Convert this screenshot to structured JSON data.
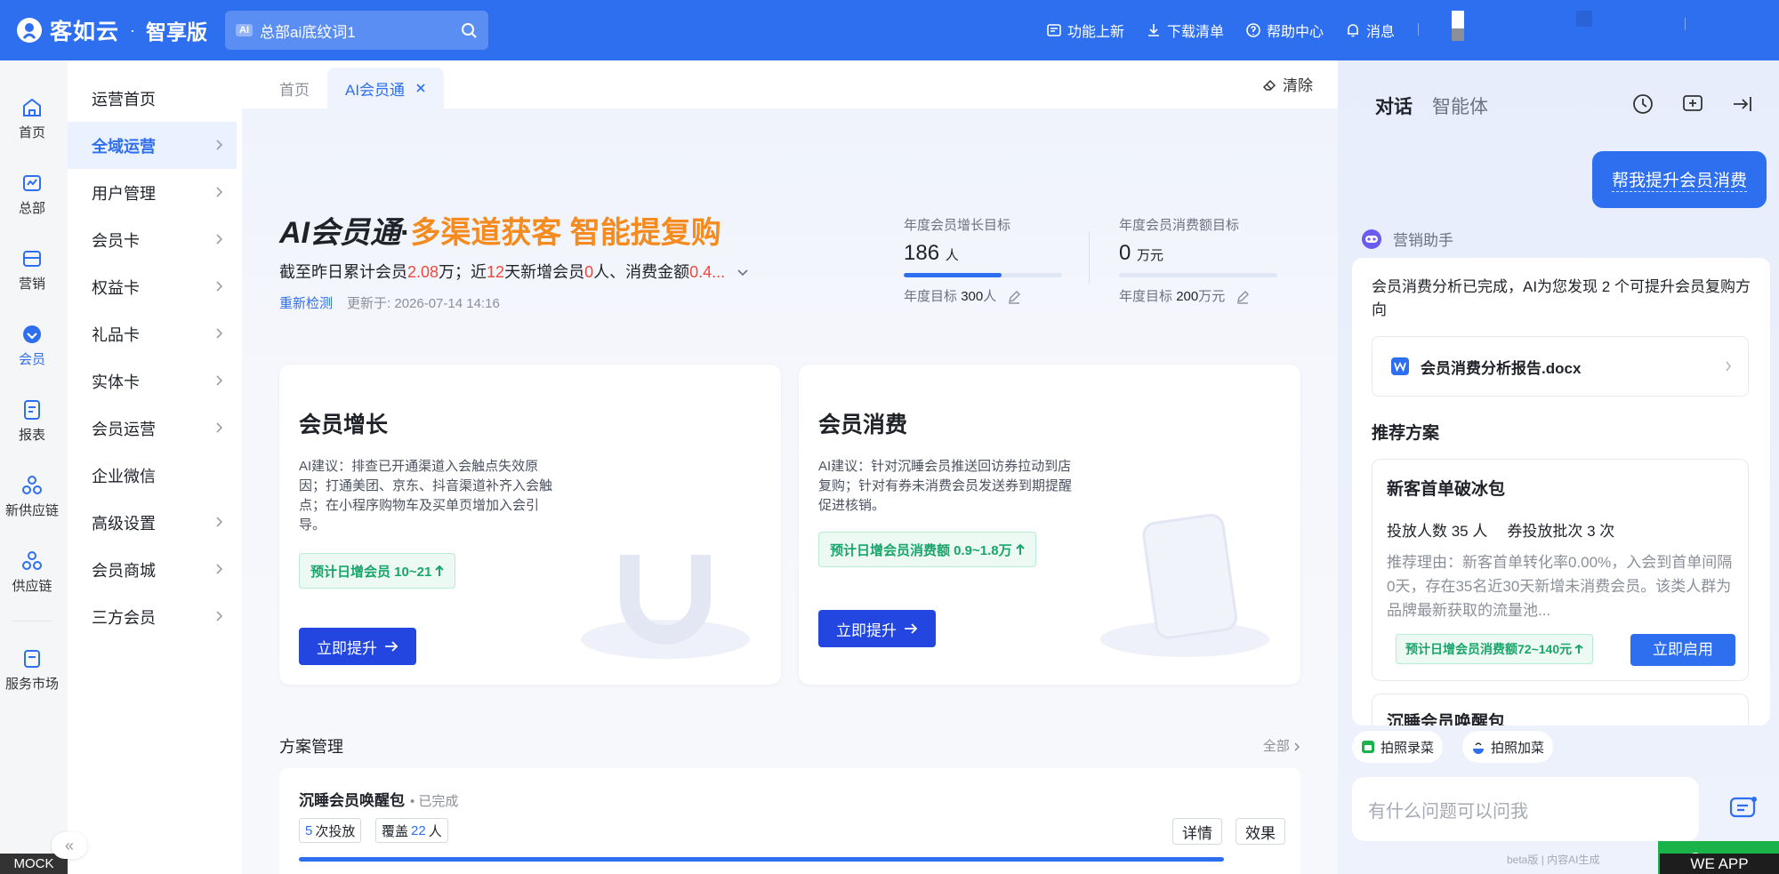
{
  "topbar": {
    "brand": "客如云",
    "dot": "·",
    "edition": "智享版",
    "company_badge": "AI",
    "company": "总部ai底纹词1",
    "nav": [
      {
        "label": "功能上新",
        "icon": "news-icon"
      },
      {
        "label": "下载清单",
        "icon": "download-icon"
      },
      {
        "label": "帮助中心",
        "icon": "help-icon"
      },
      {
        "label": "消息",
        "icon": "bell-icon"
      }
    ]
  },
  "rail": {
    "items": [
      {
        "label": "首页",
        "icon": "home-icon"
      },
      {
        "label": "总部",
        "icon": "headquarters-icon"
      },
      {
        "label": "营销",
        "icon": "marketing-icon"
      },
      {
        "label": "会员",
        "icon": "member-icon"
      },
      {
        "label": "报表",
        "icon": "report-icon"
      },
      {
        "label": "新供应链",
        "icon": "supply-chain-icon"
      },
      {
        "label": "供应链",
        "icon": "supply-chain-icon"
      },
      {
        "label": "服务市场",
        "icon": "market-icon"
      }
    ],
    "mock": "MOCK"
  },
  "menu": {
    "items": [
      {
        "label": "运营首页"
      },
      {
        "label": "全域运营"
      },
      {
        "label": "用户管理"
      },
      {
        "label": "会员卡"
      },
      {
        "label": "权益卡"
      },
      {
        "label": "礼品卡"
      },
      {
        "label": "实体卡"
      },
      {
        "label": "会员运营"
      },
      {
        "label": "企业微信"
      },
      {
        "label": "高级设置"
      },
      {
        "label": "会员商城"
      },
      {
        "label": "三方会员"
      }
    ],
    "collapse": "«"
  },
  "tabs": {
    "home": "首页",
    "active": "AI会员通",
    "clear": "清除"
  },
  "hero": {
    "title_ai": "AI会员通",
    "title_dot": "·",
    "title_slogan": "多渠道获客 智能提复购",
    "stats_1": "截至昨日累计会员",
    "stats_members": "2.08",
    "stats_2": "万；近",
    "stats_days": "12",
    "stats_3": "天新增会员",
    "stats_new": "0",
    "stats_4": "人、消费金额",
    "stats_amount": "0.4...",
    "recheck": "重新检测",
    "updated": "更新于: 2026-07-14 14:16"
  },
  "goals": [
    {
      "label": "年度会员增长目标",
      "value": "186",
      "unit": "人",
      "progress": 0.62,
      "target_label": "年度目标",
      "target": "300",
      "target_unit": "人"
    },
    {
      "label": "年度会员消费额目标",
      "value": "0",
      "unit": "万元",
      "progress": 0,
      "target_label": "年度目标",
      "target": "200",
      "target_unit": "万元"
    }
  ],
  "cards": [
    {
      "title": "会员增长",
      "desc": "AI建议：排查已开通渠道入会触点失效原因；打通美团、京东、抖音渠道补齐入会触点；在小程序购物车及买单页增加入会引导。",
      "tag": "预计日增会员 10~21",
      "button": "立即提升"
    },
    {
      "title": "会员消费",
      "desc": "AI建议：针对沉睡会员推送回访券拉动到店复购；针对有券未消费会员发送券到期提醒促进核销。",
      "tag": "预计日增会员消费额 0.9~1.8万",
      "button": "立即提升"
    }
  ],
  "plans": {
    "title": "方案管理",
    "all": "全部",
    "item": {
      "name": "沉睡会员唤醒包",
      "status": "• 已完成",
      "times": "5",
      "times_label": "次投放",
      "cover_label": "覆盖",
      "cover": "22",
      "cover_unit": "人",
      "detail": "详情",
      "effect": "效果"
    }
  },
  "chat": {
    "tab_dialog": "对话",
    "tab_agent": "智能体",
    "user_message": "帮我提升会员消费",
    "bot_name": "营销助手",
    "bot_text": "会员消费分析已完成，AI为您发现 2 个可提升会员复购方向",
    "doc_name": "会员消费分析报告.docx",
    "rec_title": "推荐方案",
    "plan1": {
      "title": "新客首单破冰包",
      "count_label": "投放人数 35 人",
      "batch_label": "券投放批次 3 次",
      "reason": "推荐理由：新客首单转化率0.00%，入会到首单间隔0天，存在35名近30天新增未消费会员。该类人群为品牌最新获取的流量池...",
      "tag": "预计日增会员消费额72~140元",
      "button": "立即启用"
    },
    "plan2_title": "沉睡会员唤醒包",
    "quick1": "拍照录菜",
    "quick2": "拍照加菜",
    "input_placeholder": "有什么问题可以问我",
    "foot_note": "beta版 | 内容AI生成"
  },
  "overlays": {
    "wechat": "vC",
    "weapp": "WE APP"
  },
  "colors": {
    "primary": "#2e6ff0",
    "accent_orange": "#f58a1f",
    "positive_green": "#19a56a",
    "alert_red": "#f0473c"
  }
}
